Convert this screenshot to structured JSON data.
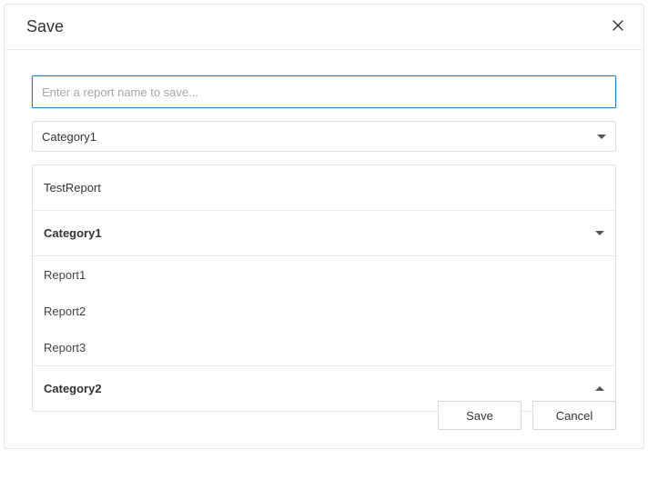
{
  "dialog": {
    "title": "Save",
    "input_placeholder": "Enter a report name to save...",
    "input_value": "",
    "selected_category": "Category1",
    "list": {
      "top_item": "TestReport",
      "groups": [
        {
          "name": "Category1",
          "expanded": true,
          "items": [
            "Report1",
            "Report2",
            "Report3"
          ]
        },
        {
          "name": "Category2",
          "expanded": false,
          "items": []
        }
      ]
    },
    "buttons": {
      "save": "Save",
      "cancel": "Cancel"
    }
  }
}
